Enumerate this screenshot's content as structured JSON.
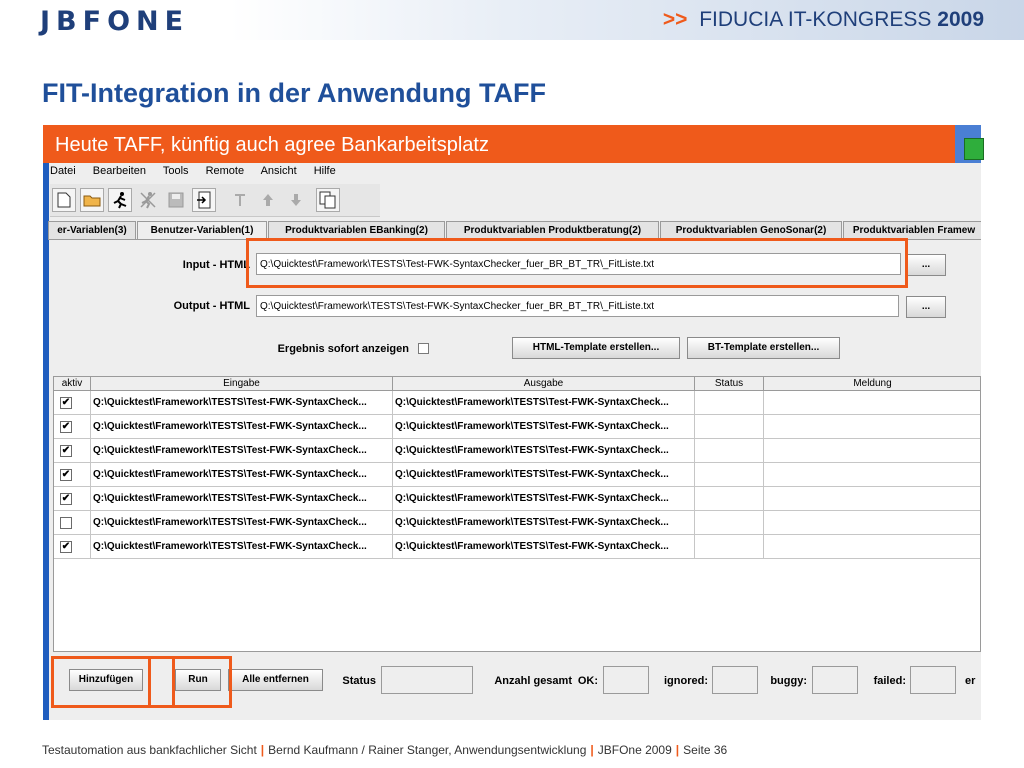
{
  "slide": {
    "logo": "JBFONE",
    "congress_arrows": ">>",
    "congress_name": "FIDUCIA IT-KONGRESS",
    "congress_year": "2009",
    "title": "FIT-Integration in der Anwendung TAFF",
    "callout": "Heute TAFF,  künftig auch  agree Bankarbeitsplatz",
    "footer": {
      "part1": "Testautomation aus bankfachlicher Sicht",
      "part2": "Bernd Kaufmann / Rainer Stanger,  Anwendungsentwicklung",
      "part3": "JBFOne 2009",
      "part4": "Seite 36"
    },
    "accent_color": "#ef5a1b",
    "brand_color": "#1f3f7a"
  },
  "app": {
    "menu": [
      "Datei",
      "Bearbeiten",
      "Tools",
      "Remote",
      "Ansicht",
      "Hilfe"
    ],
    "toolbar_icons": [
      "new-file-icon",
      "open-folder-icon",
      "run-person-icon",
      "stop-person-icon",
      "save-disk-icon",
      "exit-door-icon",
      "pin-icon",
      "arrow-up-icon",
      "arrow-down-icon",
      "copy-template-icon"
    ],
    "tabs": [
      "er-Variablen(3)",
      "Benutzer-Variablen(1)",
      "Produktvariablen EBanking(2)",
      "Produktvariablen Produktberatung(2)",
      "Produktvariablen GenoSonar(2)",
      "Produktvariablen Framew"
    ],
    "active_tab": 1,
    "input_label": "Input - HTML",
    "input_value": "Q:\\Quicktest\\Framework\\TESTS\\Test-FWK-SyntaxChecker_fuer_BR_BT_TR\\_FitListe.txt",
    "output_label": "Output - HTML",
    "output_value": "Q:\\Quicktest\\Framework\\TESTS\\Test-FWK-SyntaxChecker_fuer_BR_BT_TR\\_FitListe.txt",
    "browse_label": "...",
    "ergebnis_label": "Ergebnis sofort anzeigen",
    "ergebnis_checked": false,
    "html_template_btn": "HTML-Template erstellen...",
    "bt_template_btn": "BT-Template erstellen...",
    "table": {
      "headers": [
        "aktiv",
        "Eingabe",
        "Ausgabe",
        "Status",
        "Meldung"
      ],
      "rows": [
        {
          "aktiv": true,
          "eingabe": "Q:\\Quicktest\\Framework\\TESTS\\Test-FWK-SyntaxCheck...",
          "ausgabe": "Q:\\Quicktest\\Framework\\TESTS\\Test-FWK-SyntaxCheck...",
          "status": "",
          "meldung": ""
        },
        {
          "aktiv": true,
          "eingabe": "Q:\\Quicktest\\Framework\\TESTS\\Test-FWK-SyntaxCheck...",
          "ausgabe": "Q:\\Quicktest\\Framework\\TESTS\\Test-FWK-SyntaxCheck...",
          "status": "",
          "meldung": ""
        },
        {
          "aktiv": true,
          "eingabe": "Q:\\Quicktest\\Framework\\TESTS\\Test-FWK-SyntaxCheck...",
          "ausgabe": "Q:\\Quicktest\\Framework\\TESTS\\Test-FWK-SyntaxCheck...",
          "status": "",
          "meldung": ""
        },
        {
          "aktiv": true,
          "eingabe": "Q:\\Quicktest\\Framework\\TESTS\\Test-FWK-SyntaxCheck...",
          "ausgabe": "Q:\\Quicktest\\Framework\\TESTS\\Test-FWK-SyntaxCheck...",
          "status": "",
          "meldung": ""
        },
        {
          "aktiv": true,
          "eingabe": "Q:\\Quicktest\\Framework\\TESTS\\Test-FWK-SyntaxCheck...",
          "ausgabe": "Q:\\Quicktest\\Framework\\TESTS\\Test-FWK-SyntaxCheck...",
          "status": "",
          "meldung": ""
        },
        {
          "aktiv": false,
          "eingabe": "Q:\\Quicktest\\Framework\\TESTS\\Test-FWK-SyntaxCheck...",
          "ausgabe": "Q:\\Quicktest\\Framework\\TESTS\\Test-FWK-SyntaxCheck...",
          "status": "",
          "meldung": ""
        },
        {
          "aktiv": true,
          "eingabe": "Q:\\Quicktest\\Framework\\TESTS\\Test-FWK-SyntaxCheck...",
          "ausgabe": "Q:\\Quicktest\\Framework\\TESTS\\Test-FWK-SyntaxCheck...",
          "status": "",
          "meldung": ""
        }
      ]
    },
    "bottom": {
      "hinzufuegen": "Hinzufügen",
      "run": "Run",
      "alle_entfernen": "Alle entfernen",
      "status_label": "Status",
      "anzahl_label": "Anzahl gesamt",
      "ok_label": "OK:",
      "ignored_label": "ignored:",
      "buggy_label": "buggy:",
      "failed_label": "failed:",
      "trailing_label": "er"
    }
  }
}
